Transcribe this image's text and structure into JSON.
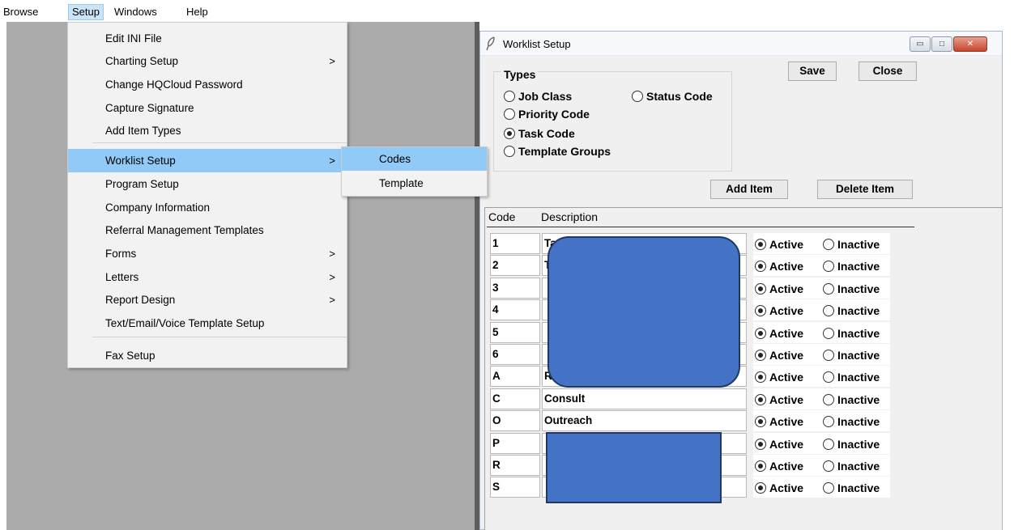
{
  "menubar": {
    "items": [
      "Browse",
      "Setup",
      "Windows",
      "Help"
    ]
  },
  "setup_menu": {
    "items": [
      {
        "label": "Edit INI File",
        "submenu": false
      },
      {
        "label": "Charting Setup",
        "submenu": true
      },
      {
        "label": "Change HQCloud Password",
        "submenu": false
      },
      {
        "label": "Capture Signature",
        "submenu": false
      },
      {
        "label": "Add Item Types",
        "submenu": false
      },
      {
        "label": "Worklist Setup",
        "submenu": true,
        "highlighted": true
      },
      {
        "label": "Program Setup",
        "submenu": false
      },
      {
        "label": "Company Information",
        "submenu": false
      },
      {
        "label": "Referral Management Templates",
        "submenu": false
      },
      {
        "label": "Forms",
        "submenu": true
      },
      {
        "label": "Letters",
        "submenu": true
      },
      {
        "label": "Report Design",
        "submenu": true
      },
      {
        "label": "Text/Email/Voice Template Setup",
        "submenu": false
      },
      {
        "label": "Fax Setup",
        "submenu": false
      }
    ],
    "arrow": ">"
  },
  "worklist_submenu": {
    "items": [
      "Codes",
      "Template"
    ],
    "highlighted": "Codes"
  },
  "dialog": {
    "title": "Worklist Setup",
    "window_buttons": {
      "minimize": "▭",
      "maximize": "□",
      "close": "✕"
    },
    "save_label": "Save",
    "close_label": "Close",
    "types": {
      "legend": "Types",
      "options": [
        "Job Class",
        "Status Code",
        "Priority Code",
        "Task Code",
        "Template Groups"
      ],
      "selected": "Task Code"
    },
    "add_item_label": "Add Item",
    "delete_item_label": "Delete Item",
    "columns": {
      "code": "Code",
      "description": "Description"
    },
    "status_labels": {
      "active": "Active",
      "inactive": "Inactive"
    },
    "rows": [
      {
        "code": "1",
        "description": "Ta",
        "status": "Active"
      },
      {
        "code": "2",
        "description": "T",
        "status": "Active"
      },
      {
        "code": "3",
        "description": "",
        "status": "Active"
      },
      {
        "code": "4",
        "description": "",
        "status": "Active"
      },
      {
        "code": "5",
        "description": "",
        "status": "Active"
      },
      {
        "code": "6",
        "description": "",
        "status": "Active"
      },
      {
        "code": "A",
        "description": "R",
        "status": "Active"
      },
      {
        "code": "C",
        "description": "Consult",
        "status": "Active"
      },
      {
        "code": "O",
        "description": "Outreach",
        "status": "Active"
      },
      {
        "code": "P",
        "description": "",
        "status": "Active"
      },
      {
        "code": "R",
        "description": "",
        "status": "Active"
      },
      {
        "code": "S",
        "description": "",
        "status": "Active"
      }
    ]
  },
  "colors": {
    "highlight": "#91c9f7",
    "redaction": "#4472c4",
    "desktop": "#ababab"
  },
  "icons": {
    "dialog_icon": "feather-icon"
  }
}
